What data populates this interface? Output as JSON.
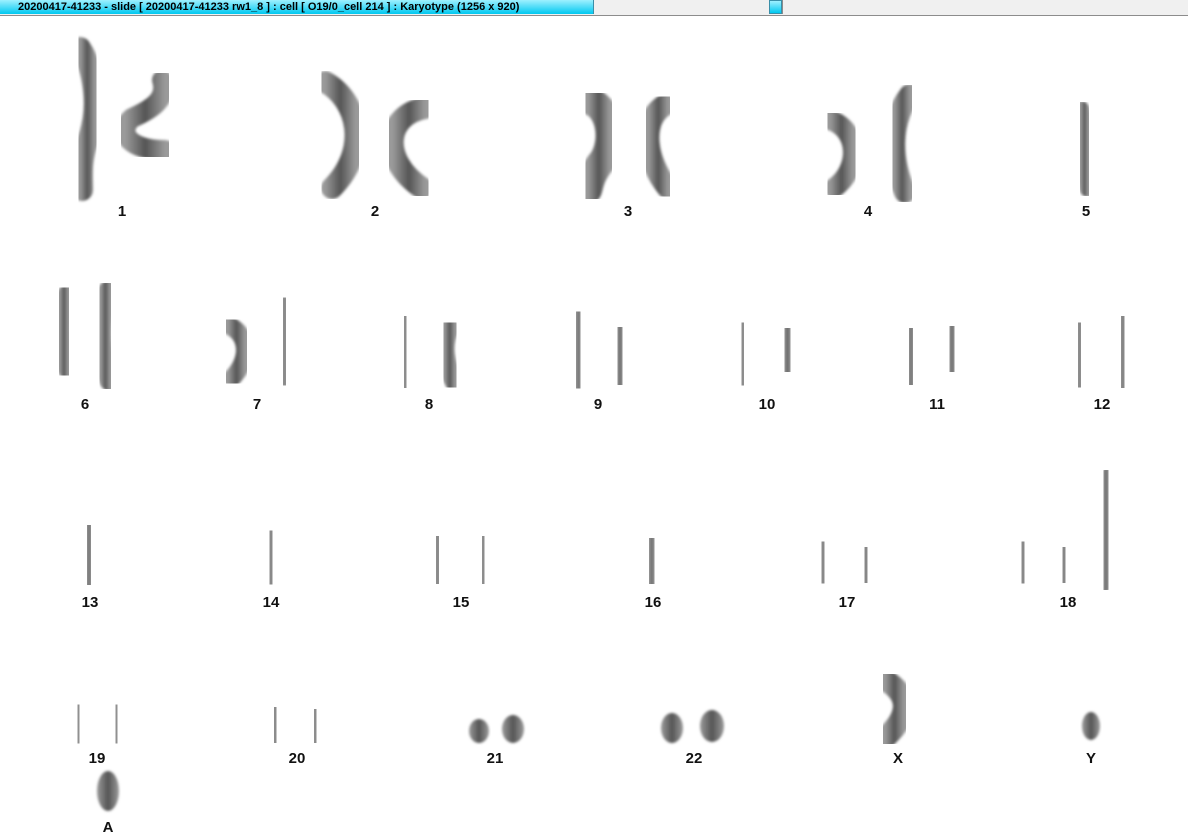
{
  "window": {
    "title": "20200417-41233 - slide [ 20200417-41233 rw1_8 ] : cell [ O19/0_cell 214 ] : Karyotype  (1256 x 920)"
  },
  "karyotype": {
    "labels": {
      "c1": "1",
      "c2": "2",
      "c3": "3",
      "c4": "4",
      "c5": "5",
      "c6": "6",
      "c7": "7",
      "c8": "8",
      "c9": "9",
      "c10": "10",
      "c11": "11",
      "c12": "12",
      "c13": "13",
      "c14": "14",
      "c15": "15",
      "c16": "16",
      "c17": "17",
      "c18": "18",
      "c19": "19",
      "c20": "20",
      "c21": "21",
      "c22": "22",
      "cx": "X",
      "cy": "Y",
      "ca": "A"
    }
  }
}
